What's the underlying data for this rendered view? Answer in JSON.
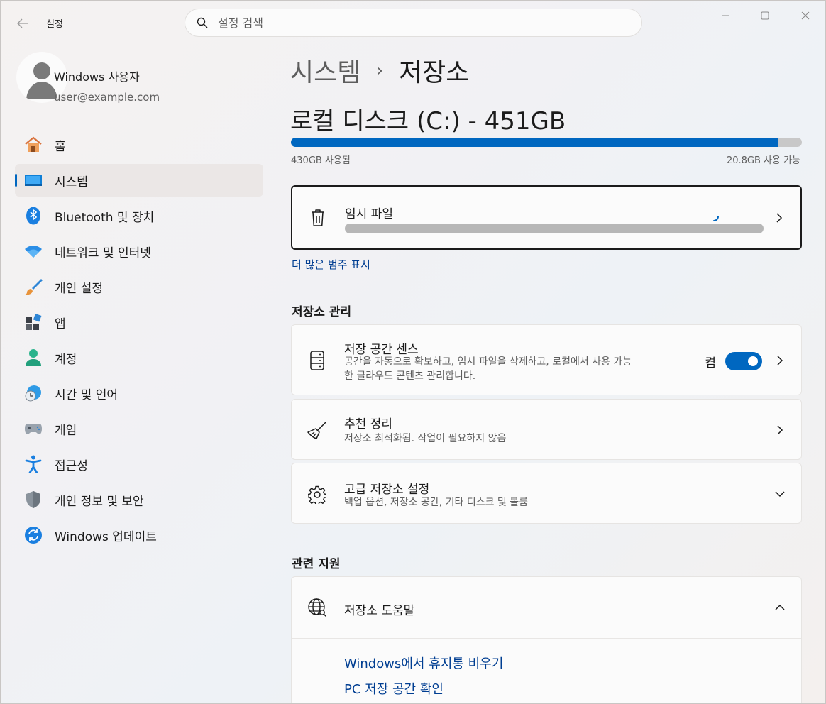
{
  "window": {
    "app_title": "설정",
    "search_placeholder": "설정 검색"
  },
  "profile": {
    "name": "Windows 사용자",
    "email": "user@example.com"
  },
  "sidebar": {
    "items": [
      {
        "label": "홈",
        "icon": "home-icon"
      },
      {
        "label": "시스템",
        "icon": "system-icon",
        "active": true
      },
      {
        "label": "Bluetooth 및 장치",
        "icon": "bluetooth-icon"
      },
      {
        "label": "네트워크 및 인터넷",
        "icon": "wifi-icon"
      },
      {
        "label": "개인 설정",
        "icon": "brush-icon"
      },
      {
        "label": "앱",
        "icon": "apps-icon"
      },
      {
        "label": "계정",
        "icon": "account-icon"
      },
      {
        "label": "시간 및 언어",
        "icon": "time-language-icon"
      },
      {
        "label": "게임",
        "icon": "gamepad-icon"
      },
      {
        "label": "접근성",
        "icon": "accessibility-icon"
      },
      {
        "label": "개인 정보 및 보안",
        "icon": "shield-icon"
      },
      {
        "label": "Windows 업데이트",
        "icon": "update-icon"
      }
    ]
  },
  "breadcrumb": {
    "parent": "시스템",
    "separator": "›",
    "current": "저장소"
  },
  "disk": {
    "title": "로컬 디스크 (C:) - 451GB",
    "used_label": "430GB 사용됨",
    "free_label": "20.8GB 사용 가능",
    "used_fraction": 0.954
  },
  "temp_files": {
    "title": "임시 파일",
    "progress_fraction": 1.0
  },
  "show_more_link": "더 많은 범주 표시",
  "storage_management": {
    "heading": "저장소 관리",
    "storage_sense": {
      "title": "저장 공간 센스",
      "description_line1": "공간을 자동으로 확보하고, 임시 파일을 삭제하고, 로컬에서 사용 가능",
      "description_line2": "한 클라우드 콘텐츠 관리합니다.",
      "toggle_label": "켬",
      "toggle_on": true
    },
    "cleanup": {
      "title": "추천 정리",
      "description": "저장소 최적화됨. 작업이 필요하지 않음"
    },
    "advanced": {
      "title": "고급 저장소 설정",
      "description": "백업 옵션, 저장소 공간, 기타 디스크 및 볼륨"
    }
  },
  "related_support": {
    "heading": "관련 지원",
    "help": {
      "title": "저장소 도움말",
      "links": [
        "Windows에서 휴지통 비우기",
        "PC 저장 공간 확인"
      ]
    }
  },
  "colors": {
    "accent": "#0067c0",
    "link": "#003e92",
    "bar_track": "#c8c8c8"
  }
}
